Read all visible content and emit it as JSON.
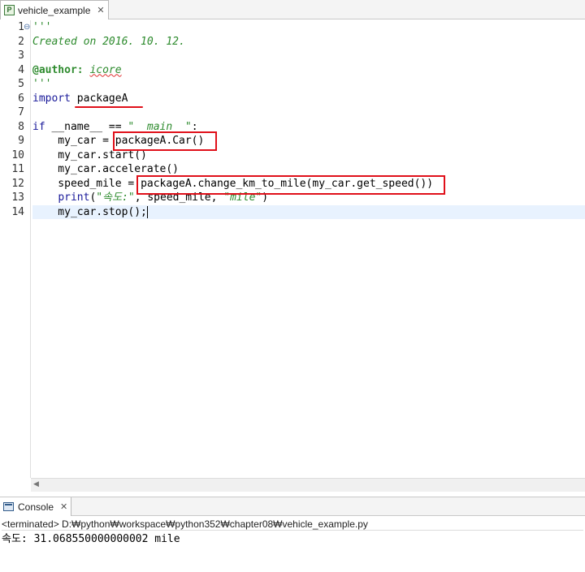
{
  "editor_tab": {
    "label": "vehicle_example",
    "close_glyph": "✕",
    "icon": "python-file-icon"
  },
  "line_numbers": [
    "1",
    "2",
    "3",
    "4",
    "5",
    "6",
    "7",
    "8",
    "9",
    "10",
    "11",
    "12",
    "13",
    "14"
  ],
  "code": {
    "l1": "'''",
    "l2": "Created on 2016. 10. 12.",
    "l4_tag": "@author:",
    "l4_name": "icore",
    "l5": "'''",
    "l6_kw": "import",
    "l6_mod": "packageA",
    "l8_kw": "if",
    "l8_mid": " __name__ == ",
    "l8_str": "\"__main__\"",
    "l8_end": ":",
    "l9_pre": "    my_car = ",
    "l9_call": "packageA.Car()",
    "l10": "    my_car.start()",
    "l11": "    my_car.accelerate()",
    "l12_pre": "    speed_mile = ",
    "l12_call": "packageA.change_km_to_mile(my_car.get_speed())",
    "l13_indent": "    ",
    "l13_fn": "print",
    "l13_open": "(",
    "l13_str1": "\"속도:\"",
    "l13_mid": ", speed_mile, ",
    "l13_str2": "\"mile\"",
    "l13_close": ")",
    "l14": "    my_car.stop();"
  },
  "console_tab": {
    "label": "Console",
    "close_glyph": "✕",
    "icon": "console-icon"
  },
  "console": {
    "status": "<terminated> D:₩python₩workspace₩python352₩chapter08₩vehicle_example.py",
    "output": "속도: 31.068550000000002 mile"
  },
  "colors": {
    "highlight_box": "#e0101a",
    "comment": "#2e8b2e",
    "keyword": "#1a1a9a",
    "current_line": "#e8f2fe"
  }
}
